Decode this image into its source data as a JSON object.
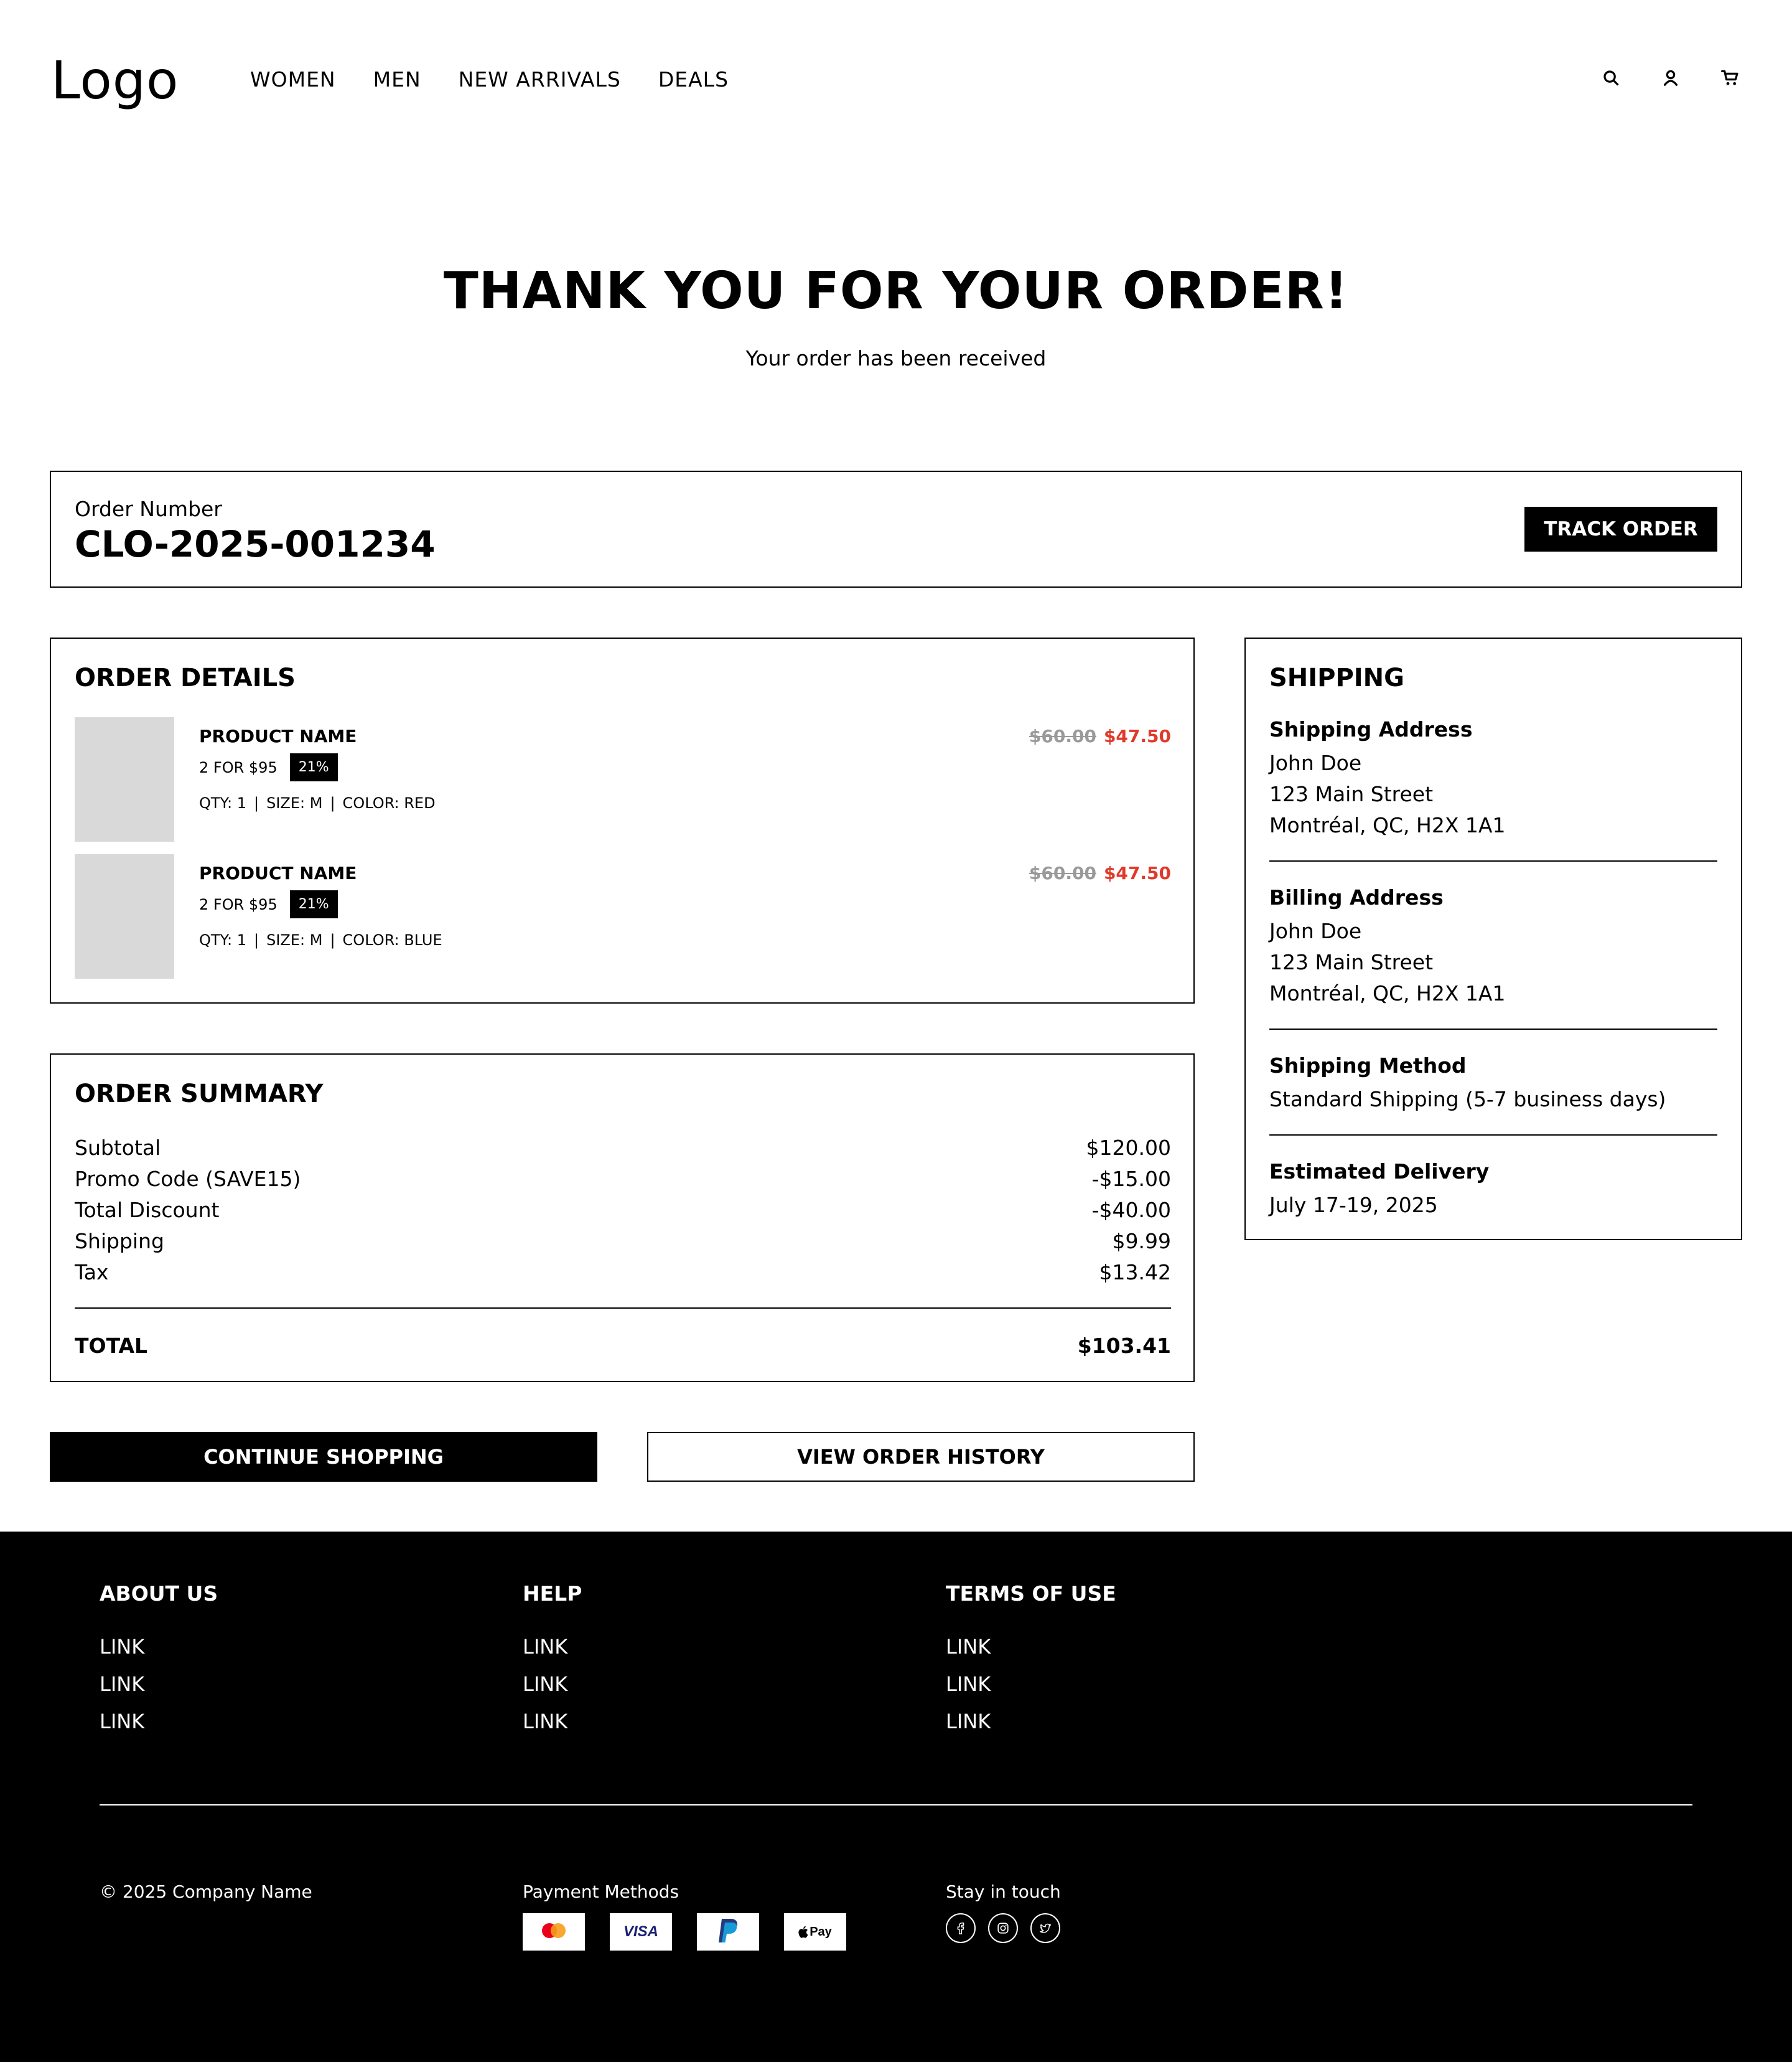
{
  "header": {
    "logo": "Logo",
    "nav": [
      "WOMEN",
      "MEN",
      "NEW ARRIVALS",
      "DEALS"
    ],
    "icons": [
      "search-icon",
      "user-icon",
      "cart-icon"
    ]
  },
  "hero": {
    "title": "THANK YOU FOR YOUR ORDER!",
    "subtitle": "Your order has been received"
  },
  "order_number": {
    "label": "Order Number",
    "value": "CLO-2025-001234",
    "track_label": "TRACK ORDER"
  },
  "order_details": {
    "title": "ORDER DETAILS",
    "items": [
      {
        "name": "PRODUCT NAME",
        "offer": "2 FOR $95",
        "badge": "21%",
        "qty": "QTY: 1",
        "size": "SIZE: M",
        "color": "COLOR: RED",
        "sep": "|",
        "old_price": "$60.00",
        "new_price": "$47.50"
      },
      {
        "name": "PRODUCT NAME",
        "offer": "2 FOR $95",
        "badge": "21%",
        "qty": "QTY: 1",
        "size": "SIZE: M",
        "color": "COLOR: BLUE",
        "sep": "|",
        "old_price": "$60.00",
        "new_price": "$47.50"
      }
    ]
  },
  "order_summary": {
    "title": "ORDER SUMMARY",
    "rows": [
      {
        "label": "Subtotal",
        "value": "$120.00"
      },
      {
        "label": "Promo Code (SAVE15)",
        "value": "-$15.00"
      },
      {
        "label": "Total Discount",
        "value": "-$40.00"
      },
      {
        "label": "Shipping",
        "value": "$9.99"
      },
      {
        "label": "Tax",
        "value": "$13.42"
      }
    ],
    "total_label": "TOTAL",
    "total_value": "$103.41"
  },
  "shipping": {
    "title": "SHIPPING",
    "shipping_address": {
      "title": "Shipping Address",
      "lines": [
        "John Doe",
        "123 Main Street",
        "Montréal, QC, H2X 1A1"
      ]
    },
    "billing_address": {
      "title": "Billing Address",
      "lines": [
        "John Doe",
        "123 Main Street",
        "Montréal, QC, H2X 1A1"
      ]
    },
    "method": {
      "title": "Shipping Method",
      "value": "Standard Shipping (5-7 business days)"
    },
    "delivery": {
      "title": "Estimated Delivery",
      "value": "July 17-19, 2025"
    }
  },
  "actions": {
    "continue_label": "CONTINUE SHOPPING",
    "history_label": "VIEW ORDER HISTORY"
  },
  "footer": {
    "columns": [
      {
        "title": "ABOUT US",
        "links": [
          "LINK",
          "LINK",
          "LINK"
        ]
      },
      {
        "title": "HELP",
        "links": [
          "LINK",
          "LINK",
          "LINK"
        ]
      },
      {
        "title": "TERMS OF USE",
        "links": [
          "LINK",
          "LINK",
          "LINK"
        ]
      }
    ],
    "copyright": "© 2025 Company Name",
    "payment_label": "Payment Methods",
    "payment_methods": [
      "mastercard-icon",
      "visa-icon",
      "paypal-icon",
      "apple-pay-icon"
    ],
    "visa_text": "VISA",
    "applepay_text": "Pay",
    "social_label": "Stay in touch",
    "social": [
      "facebook-icon",
      "instagram-icon",
      "twitter-icon"
    ]
  },
  "colors": {
    "accent_sale": "#e03a2a",
    "strike": "#9a9a9a",
    "placeholder": "#d9d9d9",
    "footer_bg": "#000000"
  }
}
